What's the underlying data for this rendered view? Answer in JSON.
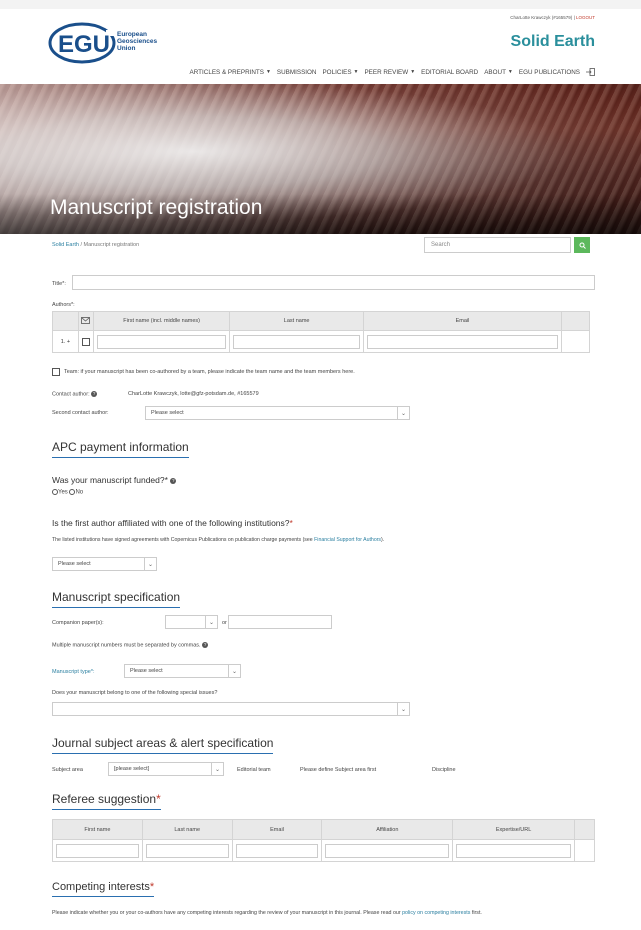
{
  "header": {
    "user_name": "CharLotte Krawczyk",
    "user_id": "(#165579)",
    "logout": "LOGOUT",
    "logo_letters": "EGU",
    "logo_line1": "European",
    "logo_line2": "Geosciences",
    "logo_line3": "Union",
    "journal_title": "Solid Earth",
    "nav": [
      {
        "label": "ARTICLES & PREPRINTS",
        "caret": "▼"
      },
      {
        "label": "SUBMISSION",
        "caret": ""
      },
      {
        "label": "POLICIES",
        "caret": "▼"
      },
      {
        "label": "PEER REVIEW",
        "caret": "▼"
      },
      {
        "label": "EDITORIAL BOARD",
        "caret": ""
      },
      {
        "label": "ABOUT",
        "caret": "▼"
      },
      {
        "label": "EGU PUBLICATIONS",
        "caret": ""
      }
    ]
  },
  "hero": {
    "title": "Manuscript registration"
  },
  "breadcrumb": {
    "home": "Solid Earth",
    "sep": "/",
    "current": "Manuscript registration"
  },
  "search": {
    "placeholder": "Search"
  },
  "form": {
    "title_label": "Title*:",
    "authors_label": "Authors*:",
    "authors_table": {
      "col_first": "First name (incl. middle names)",
      "col_last": "Last name",
      "col_email": "Email",
      "row_index": "1.",
      "row_add": "+"
    },
    "team_text": "Team: if your manuscript has been co-authored by a team, please indicate the team name and the team members here.",
    "contact_label": "Contact author:",
    "contact_value": "CharLotte Krawczyk, lotte@gfz-potsdam.de, #165579",
    "second_contact_label": "Second contact author:",
    "second_contact_value": "Please select"
  },
  "apc": {
    "heading": "APC payment information",
    "funded_q": "Was your manuscript funded?*",
    "yes": "Yes",
    "no": "No",
    "affiliated_q": "Is the first author affiliated with one of the following institutions?",
    "req": "*",
    "note_before": "The listed institutions have signed agreements with Copernicus Publications on publication charge payments (see ",
    "note_link": "Financial Support for Authors",
    "note_after": ").",
    "select_value": "Please select"
  },
  "spec": {
    "heading": "Manuscript specification",
    "companion_label": "Companion paper(s):",
    "or": "or",
    "multiple_note": "Multiple manuscript numbers must be separated by commas.",
    "type_label": "Manuscript type*:",
    "type_value": "Please select",
    "special_q": "Does your manuscript belong to one of the following special issues?"
  },
  "subject": {
    "heading": "Journal subject areas & alert specification",
    "area_label": "Subject area",
    "area_value": "[please select]",
    "editorial_label": "Editorial team",
    "editorial_note": "Please define Subject area first",
    "discipline_label": "Discipline"
  },
  "referee": {
    "heading": "Referee suggestion",
    "req": "*",
    "cols": [
      "First name",
      "Last name",
      "Email",
      "Affiliation",
      "Expertise/URL"
    ]
  },
  "competing": {
    "heading": "Competing interests",
    "req": "*",
    "text_before": "Please indicate whether you or your co-authors have any competing interests regarding the review of your manuscript in this journal. Please read our ",
    "text_link1": "policy on",
    "text_link2": "competing interests",
    "text_after": " first."
  }
}
